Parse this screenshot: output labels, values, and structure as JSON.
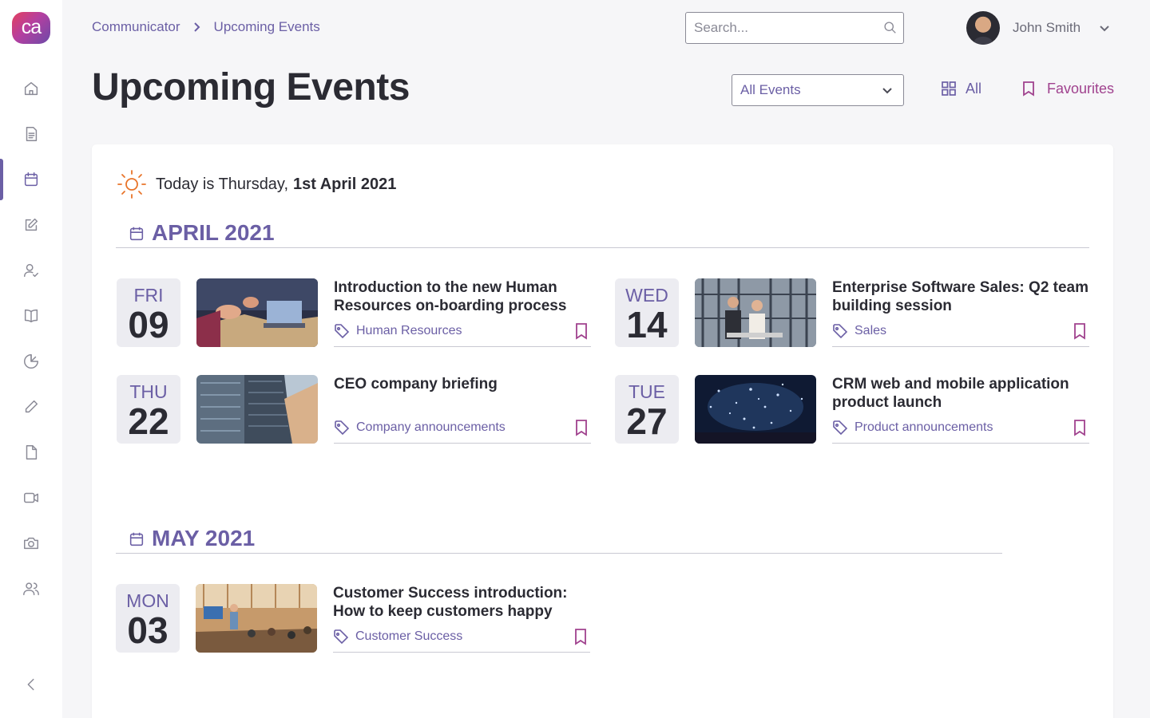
{
  "app": {
    "logo_text": "ca"
  },
  "breadcrumb": {
    "root": "Communicator",
    "current": "Upcoming Events"
  },
  "search": {
    "placeholder": "Search..."
  },
  "user": {
    "name": "John Smith"
  },
  "page": {
    "title": "Upcoming Events",
    "filter_label": "All Events",
    "view_all_label": "All",
    "favourites_label": "Favourites"
  },
  "today": {
    "prefix": "Today is Thursday,",
    "date": "1st April 2021"
  },
  "months": [
    {
      "label": "APRIL 2021",
      "events": [
        {
          "dow": "FRI",
          "day": "09",
          "title": "Introduction to the new Human Resources on-boarding process",
          "tag": "Human Resources"
        },
        {
          "dow": "WED",
          "day": "14",
          "title": "Enterprise Software Sales: Q2 team building session",
          "tag": "Sales"
        },
        {
          "dow": "THU",
          "day": "22",
          "title": "CEO company briefing",
          "tag": "Company announcements"
        },
        {
          "dow": "TUE",
          "day": "27",
          "title": "CRM web and mobile application product launch",
          "tag": "Product announcements"
        }
      ]
    },
    {
      "label": "MAY 2021",
      "events": [
        {
          "dow": "MON",
          "day": "03",
          "title": "Customer Success introduction: How to keep customers happy",
          "tag": "Customer Success"
        }
      ]
    }
  ],
  "sidebar": {
    "items": [
      {
        "icon": "home-icon"
      },
      {
        "icon": "document-icon"
      },
      {
        "icon": "calendar-icon",
        "active": true
      },
      {
        "icon": "edit-icon"
      },
      {
        "icon": "user-check-icon"
      },
      {
        "icon": "book-icon"
      },
      {
        "icon": "pie-chart-icon"
      },
      {
        "icon": "pencil-icon"
      },
      {
        "icon": "file-icon"
      },
      {
        "icon": "video-icon"
      },
      {
        "icon": "camera-icon"
      },
      {
        "icon": "users-icon"
      }
    ],
    "collapse_icon": "chevron-left-icon"
  },
  "colors": {
    "accent": "#6b5fa5",
    "favourite": "#a0428e",
    "sun": "#e8742a"
  }
}
